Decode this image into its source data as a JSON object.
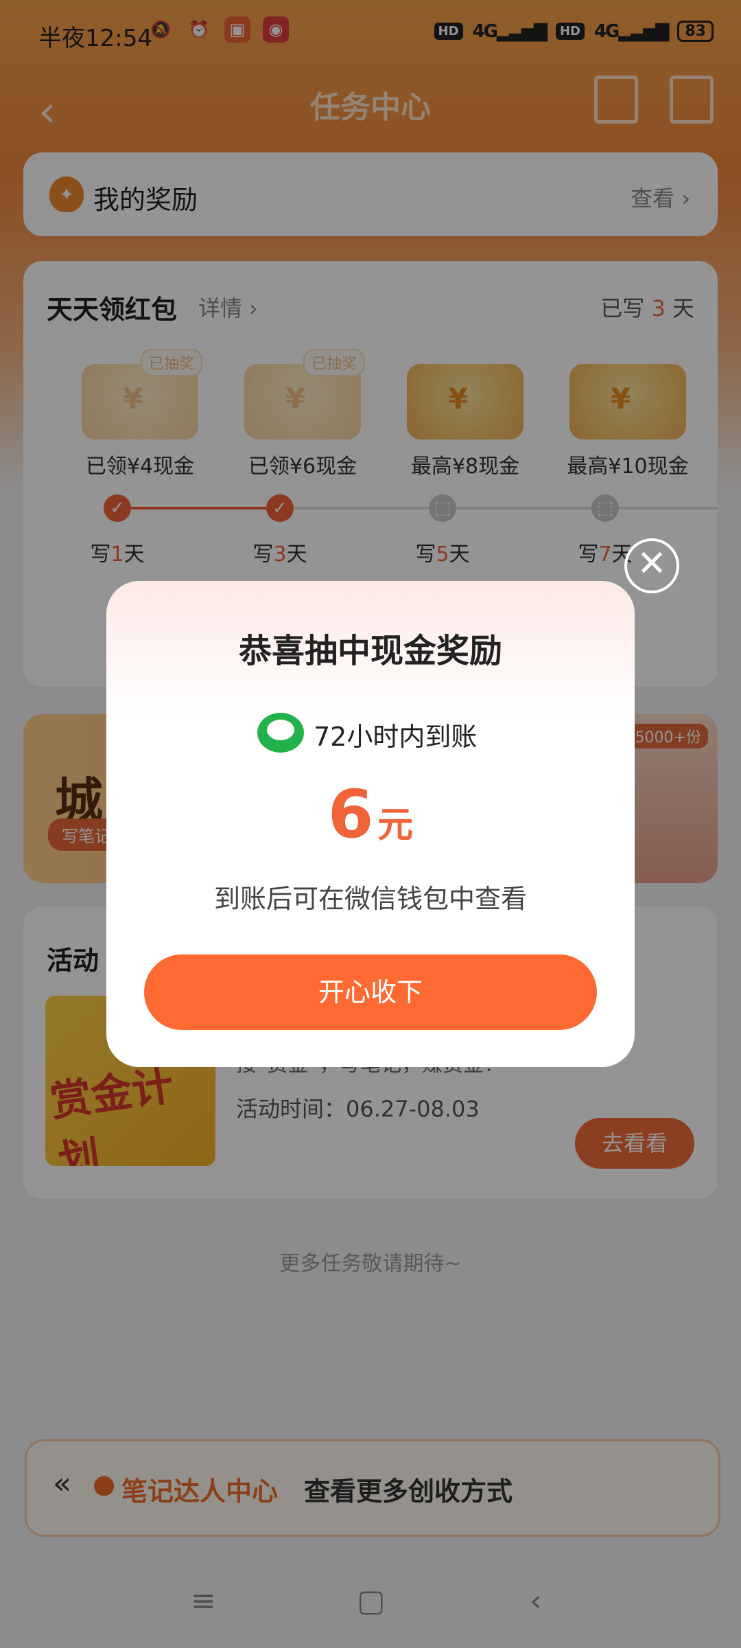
{
  "status_bar": {
    "time": "半夜12:54",
    "battery": "83",
    "network1": "4G",
    "network2": "4G",
    "hd1": "HD",
    "hd2": "HD"
  },
  "nav": {
    "title": "任务中心",
    "back_icon": "chevron-left-icon",
    "list_icon": "document-list-icon",
    "share_icon": "share-icon"
  },
  "rewards": {
    "title": "我的奖励",
    "view": "查看 ›"
  },
  "daily": {
    "title": "天天领红包",
    "detail": "详情 ›",
    "written_prefix": "已写",
    "written_days": "3",
    "written_suffix": "天",
    "tiers": [
      {
        "label": "已领¥4现金",
        "badge": "已抽奖"
      },
      {
        "label": "已领¥6现金",
        "badge": "已抽奖"
      },
      {
        "label": "最高¥8现金",
        "badge": ""
      },
      {
        "label": "最高¥10现金",
        "badge": ""
      }
    ],
    "days": [
      {
        "prefix": "写",
        "num": "1",
        "suffix": "天"
      },
      {
        "prefix": "写",
        "num": "3",
        "suffix": "天"
      },
      {
        "prefix": "写",
        "num": "5",
        "suffix": "天"
      },
      {
        "prefix": "写",
        "num": "7",
        "suffix": "天"
      }
    ]
  },
  "banner": {
    "text": "城",
    "tag": "写笔记",
    "count": "5000+份"
  },
  "activity": {
    "title": "活动",
    "image_text": "赏金计划",
    "desc": "接“赏金”，写笔记，赚赏金！",
    "time": "活动时间：06.27-08.03",
    "button": "去看看"
  },
  "more_tasks": "更多任务敬请期待~",
  "bottom_bar": {
    "arrows": "«",
    "link": "笔记达人中心",
    "more": "查看更多创收方式"
  },
  "modal": {
    "title": "恭喜抽中现金奖励",
    "arrival": "72小时内到账",
    "amount": "6",
    "unit": "元",
    "note": "到账后可在微信钱包中查看",
    "button": "开心收下",
    "close": "✕"
  },
  "colors": {
    "accent": "#f0643a",
    "button": "#ff6a33",
    "wechat": "#22b24c"
  }
}
